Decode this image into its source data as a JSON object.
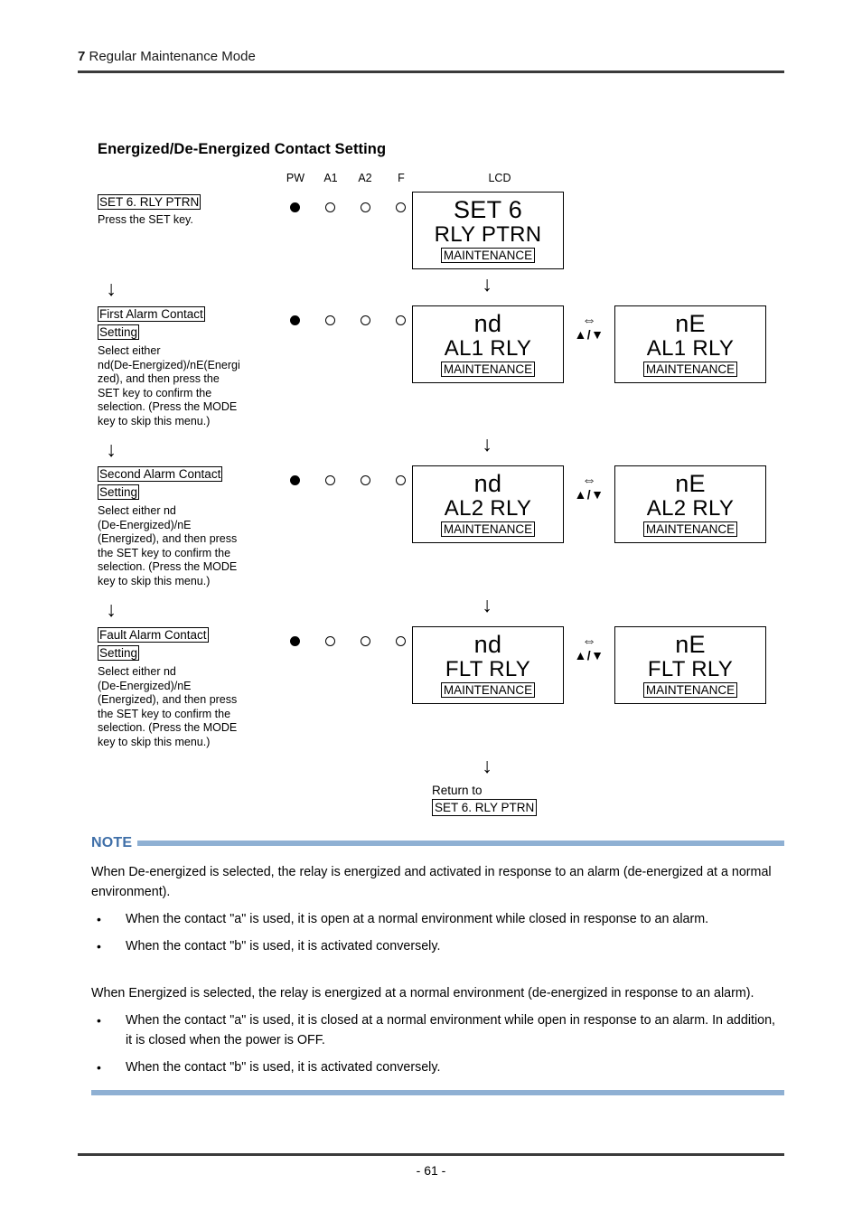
{
  "header": {
    "chapter_number": "7",
    "chapter_title": " Regular Maintenance Mode"
  },
  "section": {
    "title": "Energized/De-Energized Contact Setting"
  },
  "colors": {
    "note_accent": "#3f6fa8",
    "note_bar": "#8fb0d3",
    "rule": "#3a3a3a"
  },
  "diagram": {
    "column_headers": {
      "pw": "PW",
      "a1": "A1",
      "a2": "A2",
      "f": "F",
      "lcd": "LCD"
    },
    "led_states": [
      "on",
      "off",
      "off",
      "off"
    ],
    "toggle": {
      "left_right": "⇔",
      "up_down": "▲/▼"
    },
    "arrow_glyph": "↓",
    "steps": [
      {
        "title_line1": "SET 6. RLY PTRN",
        "title_line2": "",
        "body": "Press the SET key.",
        "leds": [
          "on",
          "off",
          "off",
          "off"
        ],
        "panel_left": {
          "line1": "SET 6",
          "line2": "RLY PTRN",
          "tag": "MAINTENANCE"
        },
        "panel_right": null
      },
      {
        "title_line1": "First Alarm Contact",
        "title_line2": "Setting",
        "body": "Select either nd(De-Energized)/nE(Energized), and then press the SET key to confirm the selection. (Press the MODE key to skip this menu.)",
        "body_lines": [
          "Select either",
          "nd(De-Energized)/nE(Energi",
          "zed), and then press the",
          "SET key to confirm the",
          "selection. (Press the MODE",
          "key to skip this menu.)"
        ],
        "leds": [
          "on",
          "off",
          "off",
          "off"
        ],
        "panel_left": {
          "line1": "nd",
          "line2": "AL1 RLY",
          "tag": "MAINTENANCE"
        },
        "panel_right": {
          "line1": "nE",
          "line2": "AL1 RLY",
          "tag": "MAINTENANCE"
        }
      },
      {
        "title_line1": "Second Alarm Contact",
        "title_line2": "Setting",
        "body": "Select either nd (De-Energized)/nE (Energized), and then press the SET key to confirm the selection. (Press the MODE key to skip this menu.)",
        "body_lines": [
          "Select either nd",
          "(De-Energized)/nE",
          "(Energized), and then press",
          "the SET key to confirm the",
          "selection. (Press the MODE",
          "key to skip this menu.)"
        ],
        "leds": [
          "on",
          "off",
          "off",
          "off"
        ],
        "panel_left": {
          "line1": "nd",
          "line2": "AL2 RLY",
          "tag": "MAINTENANCE"
        },
        "panel_right": {
          "line1": "nE",
          "line2": "AL2 RLY",
          "tag": "MAINTENANCE"
        }
      },
      {
        "title_line1": "Fault Alarm Contact",
        "title_line2": "Setting",
        "body": "Select either nd (De-Energized)/nE (Energized), and then press the SET key to confirm the selection. (Press the MODE key to skip this menu.)",
        "body_lines": [
          "Select either nd",
          "(De-Energized)/nE",
          "(Energized), and then press",
          "the SET key to confirm the",
          "selection. (Press the MODE",
          "key to skip this menu.)"
        ],
        "leds": [
          "on",
          "off",
          "off",
          "off"
        ],
        "panel_left": {
          "line1": "nd",
          "line2": "FLT RLY",
          "tag": "MAINTENANCE"
        },
        "panel_right": {
          "line1": "nE",
          "line2": "FLT RLY",
          "tag": "MAINTENANCE"
        }
      }
    ],
    "return": {
      "label": "Return to",
      "target": "SET 6. RLY PTRN"
    }
  },
  "note": {
    "label": "NOTE",
    "paragraph1": "When De-energized is selected, the relay is energized and activated in response to an alarm (de-energized at a normal environment).",
    "bullets1": [
      "When the contact \"a\" is used, it is open at a normal environment while closed in response to an alarm.",
      "When the contact \"b\" is used, it is activated conversely."
    ],
    "paragraph2": "When Energized is selected, the relay is energized at a normal environment (de-energized in response to an alarm).",
    "bullets2": [
      "When the contact \"a\" is used, it is closed at a normal environment while open in response to an alarm. In addition, it is closed when the power is OFF.",
      "When the contact \"b\" is used, it is activated conversely."
    ],
    "bullet_glyph": "•"
  },
  "footer": {
    "page_number": "- 61 -"
  }
}
